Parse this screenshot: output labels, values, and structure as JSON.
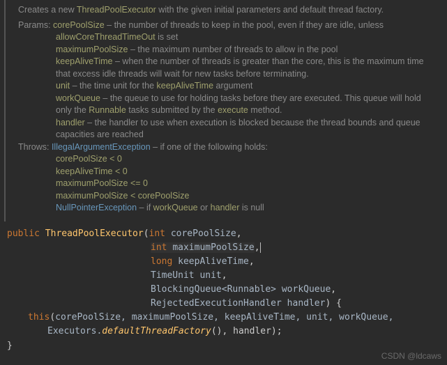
{
  "doc": {
    "summary_prefix": "Creates a new ",
    "summary_class": "ThreadPoolExecutor",
    "summary_suffix": " with the given initial parameters and default thread factory.",
    "params_label": "Params:",
    "throws_label": "Throws:",
    "params": {
      "p0_name": "corePoolSize",
      "p0_desc": " – the number of threads to keep in the pool, even if they are idle, unless ",
      "p0_code": "allowCoreThreadTimeOut",
      "p0_tail": " is set",
      "p1_name": "maximumPoolSize",
      "p1_desc": " – the maximum number of threads to allow in the pool",
      "p2_name": "keepAliveTime",
      "p2_desc": " – when the number of threads is greater than the core, this is the maximum time that excess idle threads will wait for new tasks before terminating.",
      "p3_name": "unit",
      "p3_desc_pre": " – the time unit for the ",
      "p3_code": "keepAliveTime",
      "p3_desc_post": " argument",
      "p4_name": "workQueue",
      "p4_desc_pre": " – the queue to use for holding tasks before they are executed. This queue will hold only the ",
      "p4_code1": "Runnable",
      "p4_mid": " tasks submitted by the ",
      "p4_code2": "execute",
      "p4_desc_post": " method.",
      "p5_name": "handler",
      "p5_desc": " – the handler to use when execution is blocked because the thread bounds and queue capacities are reached"
    },
    "throws": {
      "t0_name": "IllegalArgumentException",
      "t0_desc": " – if one of the following holds:",
      "cond0": "corePoolSize < 0",
      "cond1": "keepAliveTime < 0",
      "cond2": "maximumPoolSize <= 0",
      "cond3": "maximumPoolSize < corePoolSize",
      "t1_name": "NullPointerException",
      "t1_desc_pre": " – if ",
      "t1_code1": "workQueue",
      "t1_mid": " or ",
      "t1_code2": "handler",
      "t1_desc_post": " is null"
    }
  },
  "code": {
    "l1_kw": "public ",
    "l1_name": "ThreadPoolExecutor",
    "l1_open": "(",
    "l1_t": "int ",
    "l1_p": "corePoolSize",
    "l1_comma": ",",
    "l2_t": "int ",
    "l2_p": "maximumPoolSize",
    "l2_comma": ",",
    "l3_t": "long ",
    "l3_p": "keepAliveTime",
    "l3_comma": ",",
    "l4_t": "TimeUnit ",
    "l4_p": "unit",
    "l4_comma": ",",
    "l5_t": "BlockingQueue<Runnable> ",
    "l5_p": "workQueue",
    "l5_comma": ",",
    "l6_t": "RejectedExecutionHandler ",
    "l6_p": "handler",
    "l6_close": ") {",
    "l7_this": "this",
    "l7_open": "(",
    "l7_args": "corePoolSize, maximumPoolSize, keepAliveTime, unit, workQueue,",
    "l8_pre": "Executors.",
    "l8_static": "defaultThreadFactory",
    "l8_post": "(), handler);",
    "l9": "}"
  },
  "watermark": "CSDN @ldcaws"
}
